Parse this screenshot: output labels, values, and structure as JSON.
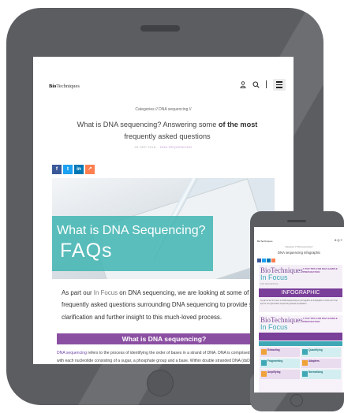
{
  "tablet": {
    "header": {
      "logo_bold": "Bio",
      "logo_rest": "Techniques"
    },
    "categories": "Categories // DNA sequencing //",
    "title_plain": "What is DNA sequencing? Answering some ",
    "title_bold": "of the most",
    "title_line2": "frequently asked questions",
    "meta_date": "26 SEP 2018",
    "meta_tag": "DNA SEQUENCING",
    "share": [
      "f",
      "t",
      "in",
      "↗"
    ],
    "hero_line1": "What is DNA Sequencing?",
    "hero_line2": "FAQs",
    "intro_1": "As part our ",
    "intro_hl": "In Focus",
    "intro_2": " on DNA sequencing, we are looking at some of the most frequently asked questions surrounding DNA sequencing to provide some clarification and further insight to this much-loved process.",
    "section_heading": "What is DNA sequencing?",
    "body_link": "DNA sequencing",
    "body_text": " refers to the process of identifying the order of bases in a strand of DNA. DNA is comprised of nucleotides, with each nucleotide consisting of a sugar, a phosphate group and a base. Within double stranded DNA (dsDNA), bases from single stranded DNA"
  },
  "phone": {
    "logo": "BioTechniques",
    "icons": "8 Q ≡",
    "categories": "Categories // DNA sequencing //",
    "title": "DNA sequencing infographic",
    "infographic1": {
      "brand1": "BioTechniques",
      "brand2": "In Focus",
      "subtitle": "5 TOP TIPS FOR DNA SAMPLE PREPARATION",
      "tag": "DNA SEQUENCING",
      "banner": "INFOGRAPHIC",
      "lines": "As part of our In Focus on DNA sequencing we put together an infographic to show our 5 top tips for next generation sequencing sample preparation."
    },
    "infographic2": {
      "brand1": "BioTechniques",
      "brand2": "In Focus",
      "subtitle": "5 TOP TIPS FOR DNA SAMPLE PREPARATION",
      "blocks": [
        "Extracting",
        "Quantifying",
        "Fragmenting",
        "Adapters",
        "Amplifying",
        "Normalizing"
      ]
    }
  }
}
